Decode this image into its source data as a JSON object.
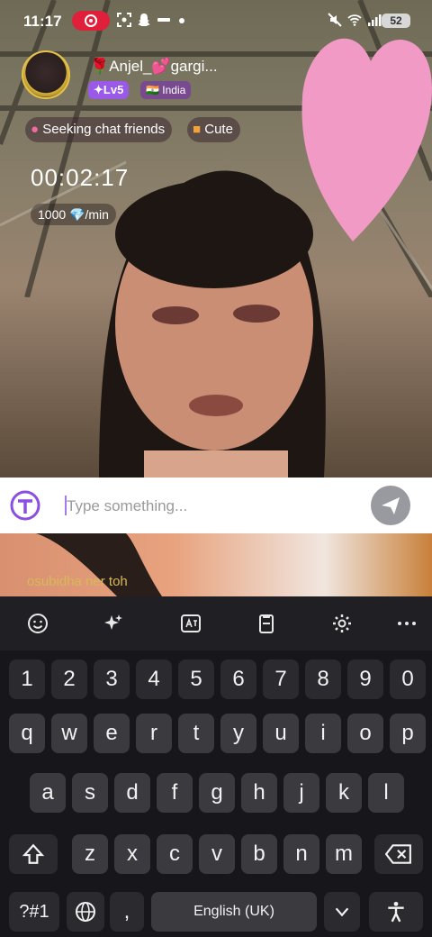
{
  "status_bar": {
    "time": "11:17",
    "battery": "52"
  },
  "host": {
    "name": "🌹Anjel_💕gargi...",
    "level": "✦Lv5",
    "country": "🇮🇳 India"
  },
  "tags": [
    {
      "label": "Seeking chat friends"
    },
    {
      "label": "Cute"
    }
  ],
  "call": {
    "timer": "00:02:17",
    "rate": "1000 💎/min"
  },
  "chat": {
    "input_placeholder": "Type something...",
    "partial_message": "osubidha ner toh"
  },
  "keyboard": {
    "number_row": [
      "1",
      "2",
      "3",
      "4",
      "5",
      "6",
      "7",
      "8",
      "9",
      "0"
    ],
    "row1": [
      "q",
      "w",
      "e",
      "r",
      "t",
      "y",
      "u",
      "i",
      "o",
      "p"
    ],
    "row2": [
      "a",
      "s",
      "d",
      "f",
      "g",
      "h",
      "j",
      "k",
      "l"
    ],
    "row3": [
      "z",
      "x",
      "c",
      "v",
      "b",
      "n",
      "m"
    ],
    "symbols_key": "?#1",
    "comma_key": ",",
    "space_label": "English (UK)",
    "toolbar_icons": [
      "emoji-icon",
      "sparkle-icon",
      "translate-icon",
      "clipboard-icon",
      "settings-icon",
      "more-icon"
    ]
  },
  "colors": {
    "accent": "#9b59e8",
    "heart": "#f19ac6",
    "record": "#e0203a"
  }
}
